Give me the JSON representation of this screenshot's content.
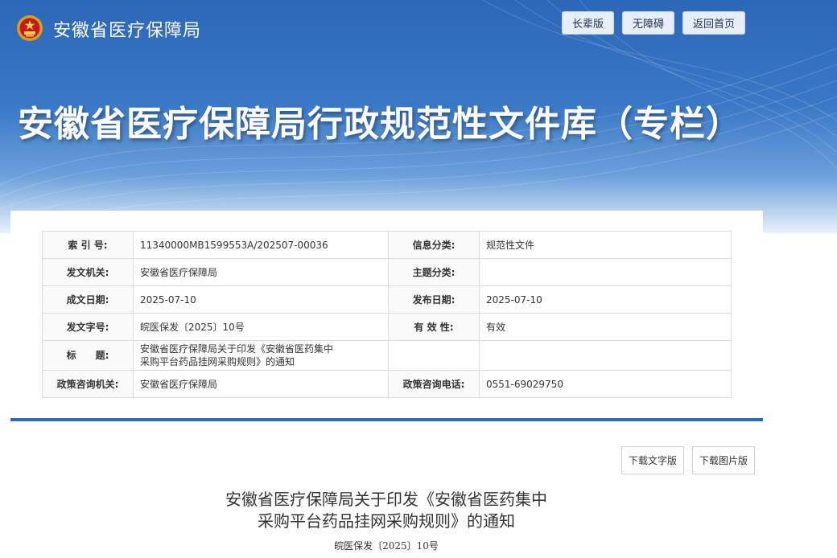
{
  "header": {
    "site_name": "安徽省医疗保障局",
    "buttons": [
      "长辈版",
      "无障碍",
      "返回首页"
    ]
  },
  "banner": {
    "title": "安徽省医疗保障局行政规范性文件库（专栏）"
  },
  "meta": {
    "rows": [
      {
        "k1": "索 引 号:",
        "v1": "11340000MB1599553A/202507-00036",
        "k2": "信息分类:",
        "v2": "规范性文件"
      },
      {
        "k1": "发文机关:",
        "v1": "安徽省医疗保障局",
        "k2": "主题分类:",
        "v2": ""
      },
      {
        "k1": "成文日期:",
        "v1": "2025-07-10",
        "k2": "发布日期:",
        "v2": "2025-07-10"
      },
      {
        "k1": "发文字号:",
        "v1": "皖医保发〔2025〕10号",
        "k2": "有 效 性:",
        "v2": "有效"
      },
      {
        "k1": "标　　题:",
        "v1": "安徽省医疗保障局关于印发《安徽省医药集中采购平台药品挂网采购规则》的通知",
        "k2": "",
        "v2": ""
      },
      {
        "k1": "政策咨询机关:",
        "v1": "安徽省医疗保障局",
        "k2": "政策咨询电话:",
        "v2": "0551-69029750"
      }
    ],
    "title_line1": "安徽省医疗保障局关于印发《安徽省医药集中",
    "title_line2": "采购平台药品挂网采购规则》的通知"
  },
  "downloads": {
    "text_version": "下载文字版",
    "image_version": "下载图片版"
  },
  "document": {
    "title_line1": "安徽省医疗保障局关于印发《安徽省医药集中",
    "title_line2": "采购平台药品挂网采购规则》的通知",
    "doc_number": "皖医保发〔2025〕10号"
  },
  "colors": {
    "banner_blue": "#2c66b8",
    "accent_line": "#2f6cb5"
  }
}
